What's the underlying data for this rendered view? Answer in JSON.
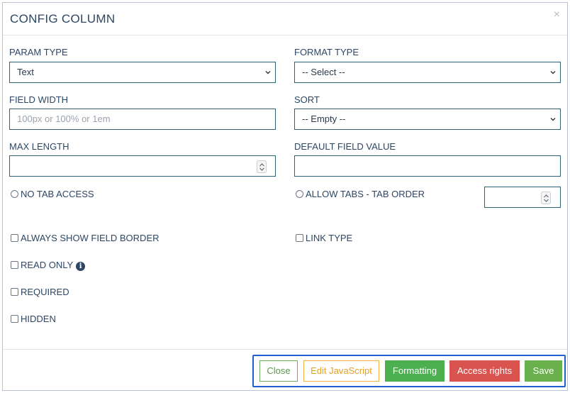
{
  "dialog": {
    "title": "CONFIG COLUMN",
    "close_glyph": "×"
  },
  "form": {
    "param_type": {
      "label": "PARAM TYPE",
      "value": "Text"
    },
    "format_type": {
      "label": "FORMAT TYPE",
      "value": "-- Select --"
    },
    "field_width": {
      "label": "FIELD WIDTH",
      "placeholder": "100px or 100% or 1em",
      "value": ""
    },
    "sort": {
      "label": "SORT",
      "value": "-- Empty --"
    },
    "max_length": {
      "label": "MAX LENGTH",
      "value": ""
    },
    "default_field_value": {
      "label": "DEFAULT FIELD VALUE",
      "value": ""
    },
    "no_tab_access": {
      "label": "NO TAB ACCESS",
      "checked": false
    },
    "allow_tabs": {
      "label": "ALLOW TABS - TAB ORDER",
      "checked": false,
      "value": ""
    },
    "always_show_border": {
      "label": "ALWAYS SHOW FIELD BORDER",
      "checked": false
    },
    "link_type": {
      "label": "LINK TYPE",
      "checked": false
    },
    "read_only": {
      "label": "READ ONLY",
      "checked": false,
      "info_glyph": "i"
    },
    "required": {
      "label": "REQUIRED",
      "checked": false
    },
    "hidden": {
      "label": "HIDDEN",
      "checked": false
    }
  },
  "footer": {
    "close": "Close",
    "edit_js": "Edit JavaScript",
    "formatting": "Formatting",
    "access_rights": "Access rights",
    "save": "Save"
  },
  "colors": {
    "accent_border": "#2e6173",
    "focus_outline": "#1f5fd1",
    "success": "#4caf50",
    "warning": "#f0b341",
    "danger": "#d9534f",
    "text": "#2c4664"
  }
}
